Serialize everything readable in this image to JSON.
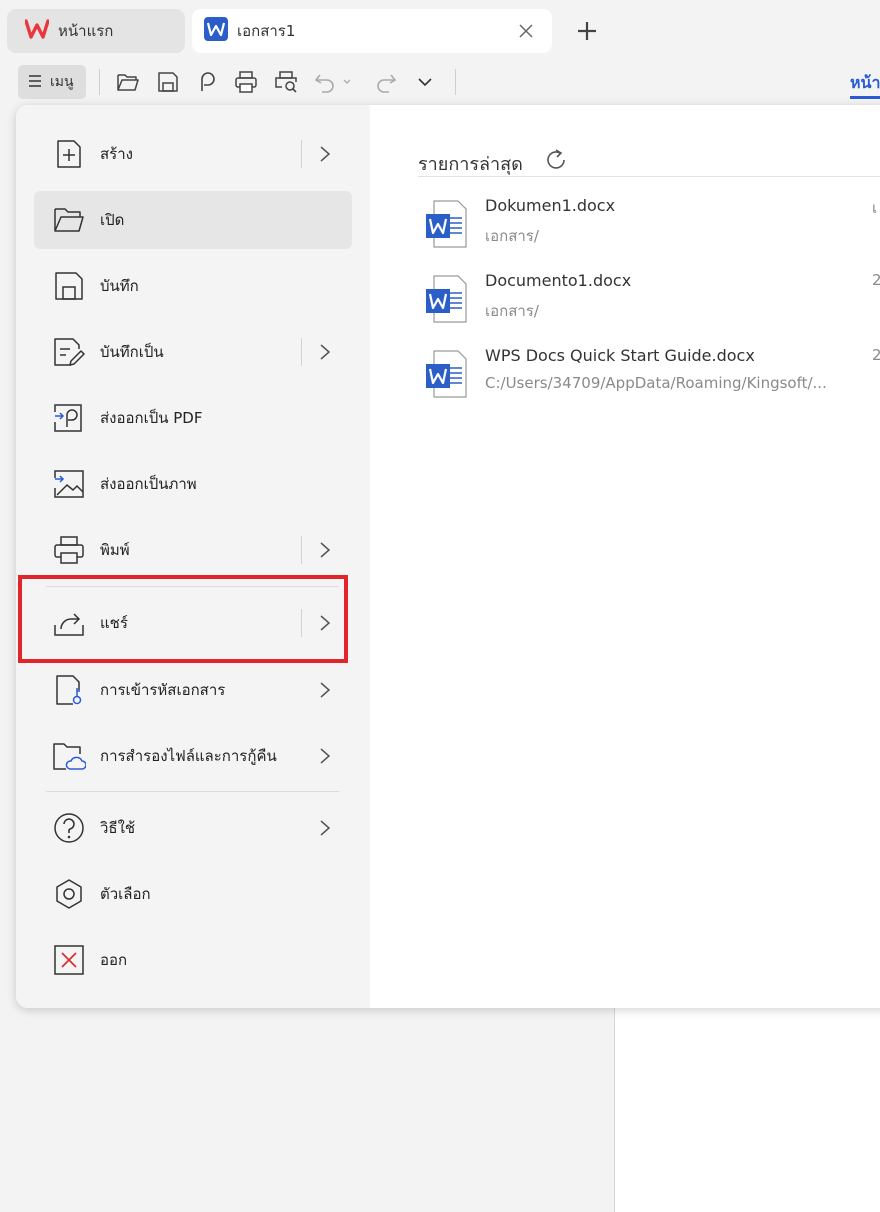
{
  "tabs": {
    "home_label": "หน้าแรก",
    "doc_label": "เอกสาร1"
  },
  "toolbar": {
    "menu_label": "เมนู",
    "icons": [
      "open-folder-icon",
      "save-icon",
      "export-pdf-icon",
      "print-icon",
      "print-preview-icon",
      "undo-icon",
      "redo-icon",
      "dropdown-icon"
    ],
    "right_tab_label": "หน้า"
  },
  "menu": {
    "items": [
      {
        "label": "สร้าง",
        "icon": "new-doc-icon",
        "has_submenu": true
      },
      {
        "label": "เปิด",
        "icon": "open-folder-icon",
        "has_submenu": false,
        "active": true
      },
      {
        "label": "บันทึก",
        "icon": "save-icon",
        "has_submenu": false
      },
      {
        "label": "บันทึกเป็น",
        "icon": "save-as-icon",
        "has_submenu": true
      },
      {
        "label": "ส่งออกเป็น PDF",
        "icon": "export-pdf-icon",
        "has_submenu": false
      },
      {
        "label": "ส่งออกเป็นภาพ",
        "icon": "export-image-icon",
        "has_submenu": false
      },
      {
        "label": "พิมพ์",
        "icon": "print-icon",
        "has_submenu": true
      },
      {
        "label": "แชร์",
        "icon": "share-icon",
        "has_submenu": true
      },
      {
        "label": "การเข้ารหัสเอกสาร",
        "icon": "encrypt-icon",
        "has_submenu": true
      },
      {
        "label": "การสำรองไฟล์และการกู้คืน",
        "icon": "backup-icon",
        "has_submenu": true
      },
      {
        "label": "วิธีใช้",
        "icon": "help-icon",
        "has_submenu": true
      },
      {
        "label": "ตัวเลือก",
        "icon": "options-icon",
        "has_submenu": false
      },
      {
        "label": "ออก",
        "icon": "exit-icon",
        "has_submenu": false
      }
    ]
  },
  "recent": {
    "title": "รายการล่าสุด",
    "files": [
      {
        "name": "Dokumen1.docx",
        "path": "เอกสาร/",
        "date": "เ"
      },
      {
        "name": "Documento1.docx",
        "path": "เอกสาร/",
        "date": "2"
      },
      {
        "name": "WPS Docs Quick Start Guide.docx",
        "path": "C:/Users/34709/AppData/Roaming/Kingsoft/...",
        "date": "2"
      }
    ]
  },
  "colors": {
    "accent": "#2a5bd7",
    "highlight": "#e0262b",
    "wps_red": "#e8383d",
    "word_blue": "#2b5fc7"
  }
}
